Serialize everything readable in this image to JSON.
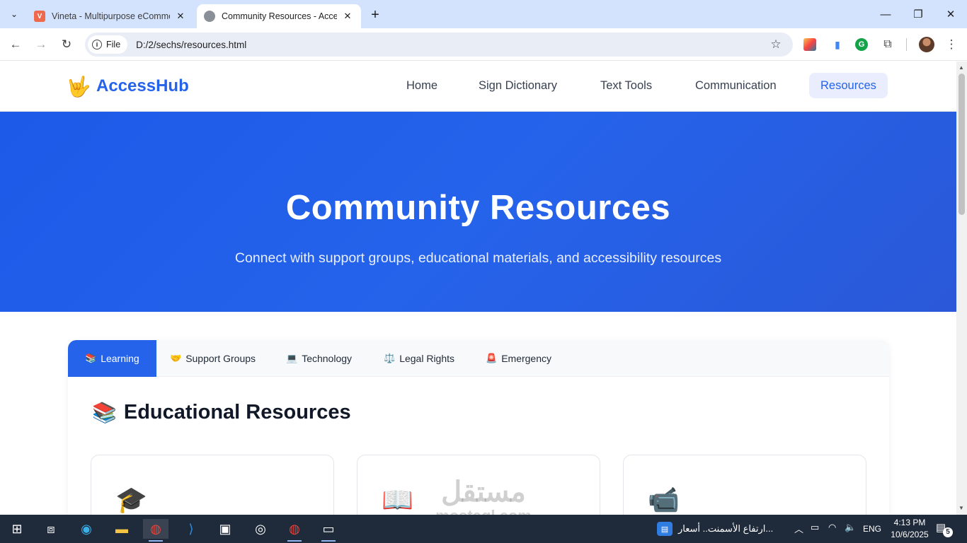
{
  "browser": {
    "tabs": [
      {
        "title": "Vineta - Multipurpose eComme",
        "favicon": "V",
        "active": false
      },
      {
        "title": "Community Resources - Access",
        "favicon": "globe-icon",
        "active": true
      }
    ],
    "new_tab_symbol": "+",
    "address_chip": "File",
    "url": "D:/2/sechs/resources.html"
  },
  "site": {
    "logo_icon": "🤟",
    "brand": "AccessHub",
    "nav": [
      "Home",
      "Sign Dictionary",
      "Text Tools",
      "Communication",
      "Resources"
    ],
    "active_nav": "Resources",
    "accent_color": "#2563eb"
  },
  "hero": {
    "title": "Community Resources",
    "subtitle": "Connect with support groups, educational materials, and accessibility resources"
  },
  "resources": {
    "tabs": [
      {
        "emoji": "📚",
        "label": "Learning"
      },
      {
        "emoji": "🤝",
        "label": "Support Groups"
      },
      {
        "emoji": "💻",
        "label": "Technology"
      },
      {
        "emoji": "⚖️",
        "label": "Legal Rights"
      },
      {
        "emoji": "🚨",
        "label": "Emergency"
      }
    ],
    "active_tab": "Learning",
    "section_emoji": "📚",
    "section_title": "Educational Resources",
    "card_icons": [
      "🎓",
      "📖",
      "📹"
    ]
  },
  "watermark": {
    "arabic": "مستقل",
    "latin": "mostaql.com"
  },
  "taskbar": {
    "news_text": "ارتفاع الأسمنت.. أسعار...",
    "language": "ENG",
    "time": "4:13 PM",
    "date": "10/6/2025",
    "notification_count": "5"
  }
}
